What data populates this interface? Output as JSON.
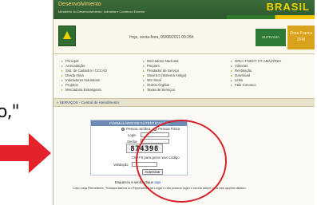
{
  "annotation": {
    "left_text": "o,\"",
    "arrow_color": "#e3232b"
  },
  "header": {
    "site_name": "Desenvolvimento",
    "ministry": "Ministério do Desenvolvimento, Indústria e Comércio Exterior",
    "brasil": "BRASIL",
    "date_text": "Hoje, sexta-feira, 05/08/2011 09:25h",
    "suframa": "SUFRAMA",
    "zfm_line1": "Zona Franca",
    "zfm_line2": "ZFM"
  },
  "menu": {
    "col1": [
      "Principal",
      "Arrecadação",
      "Sist. de Cadastro / CCCAD",
      "Dívida Ativa",
      "Indicadores Industriais",
      "Projetos",
      "Mercadoria Estrangeira"
    ],
    "col2": [
      "Mercadoria Nacional",
      "Pecpam",
      "Prestador de Serviço",
      "Sinal 5.0 (Sistema Antigo)",
      "WS Sinal",
      "Outros Órgãos",
      "Taxas de Serviços"
    ],
    "col3": [
      "GRU / FNDCT CT-AMAZÔNIA",
      "Vistorias",
      "Restituição",
      "Download",
      "Links",
      "Fale Conosco"
    ]
  },
  "breadcrumb": "» SERVIÇOS - Central de Atendimento",
  "form": {
    "title": "FORMULÁRIO DE AUTENTICAÇÃO",
    "radio_pj": "Pessoa Jurídica",
    "radio_pf": "Pessoa Física",
    "login_label": "Login",
    "senha_label": "Senha",
    "captcha": "874398",
    "captcha_hint": "Ctrl+F5 para gerar novo código",
    "validacao_label": "Validação",
    "submit": "Autenticar",
    "forgot_text": "Esqueceu a senha clique",
    "forgot_link": "aqui",
    "note": "Caso seja Remetente, Transportadora ou Representante Legal e não possuir login e senha utilize uma das opções abaixo."
  },
  "colors": {
    "header_green": "#2c5a2d",
    "form_title_bg": "#6c8bb5",
    "circle": "#d4212a"
  }
}
